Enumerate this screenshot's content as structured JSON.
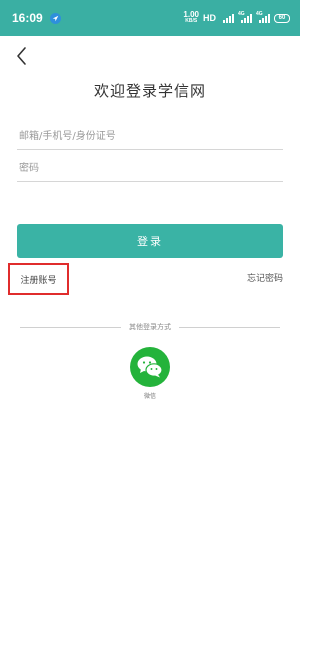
{
  "status_bar": {
    "time": "16:09",
    "net_speed": "1.00",
    "net_unit": "KB/S",
    "hd": "HD",
    "signal_1_tag": "4G",
    "signal_2_tag": "4G",
    "battery": "60"
  },
  "header": {
    "back_icon": "chevron-left-icon",
    "title": "欢迎登录学信网"
  },
  "form": {
    "account_placeholder": "邮箱/手机号/身份证号",
    "password_placeholder": "密码"
  },
  "actions": {
    "login_label": "登录",
    "register_label": "注册账号",
    "forgot_label": "忘记密码"
  },
  "other_login": {
    "divider_text": "其他登录方式",
    "wechat_label": "微信",
    "wechat_icon": "wechat-icon"
  },
  "colors": {
    "status_bar": "#3aafa3",
    "primary": "#3ab3a5",
    "highlight_box": "#e02c2c",
    "wechat": "#24b33b"
  }
}
